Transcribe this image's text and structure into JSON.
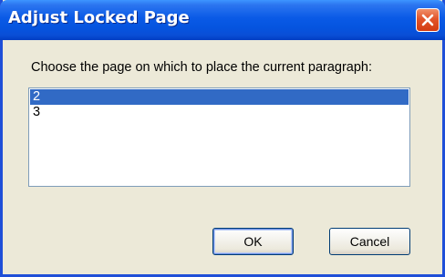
{
  "window": {
    "title": "Adjust Locked Page",
    "close_icon": "close-icon",
    "accent_color": "#0a5ae6",
    "close_color": "#e2542a"
  },
  "prompt": {
    "text": "Choose the page on which to place the current paragraph:"
  },
  "pages_list": {
    "items": [
      {
        "label": "2",
        "selected": true
      },
      {
        "label": "3",
        "selected": false
      }
    ],
    "selection_color": "#316ac5"
  },
  "buttons": {
    "ok_label": "OK",
    "cancel_label": "Cancel"
  }
}
